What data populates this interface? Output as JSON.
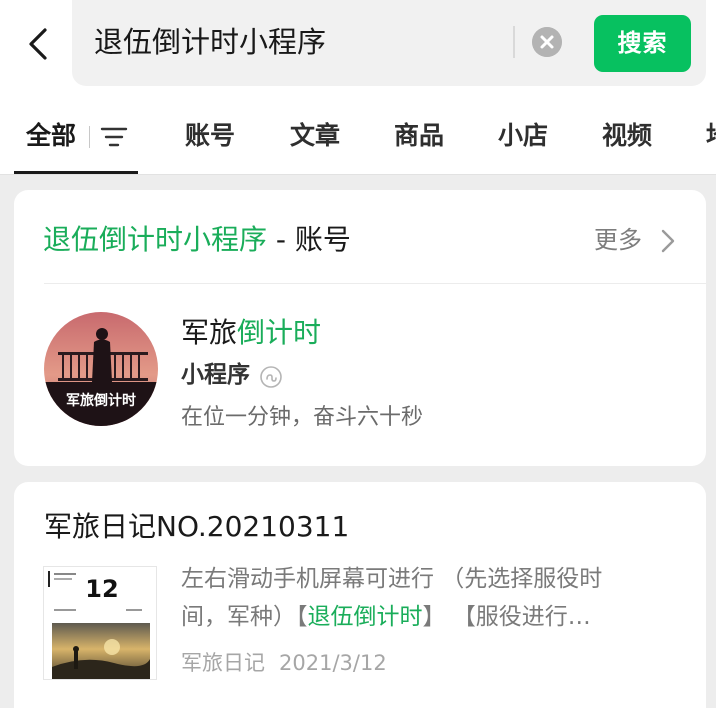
{
  "search": {
    "query": "退伍倒计时小程序",
    "button_label": "搜索"
  },
  "tabs": [
    {
      "label": "全部"
    },
    {
      "label": "账号"
    },
    {
      "label": "文章"
    },
    {
      "label": "商品"
    },
    {
      "label": "小店"
    },
    {
      "label": "视频"
    },
    {
      "label": "地"
    }
  ],
  "account_section": {
    "title_highlight": "退伍倒计时小程序",
    "title_suffix": " - 账号",
    "more_label": "更多",
    "account": {
      "name_plain": "军旅",
      "name_highlight": "倒计时",
      "type": "小程序",
      "description": "在位一分钟，奋斗六十秒",
      "avatar_text": "军旅倒计时"
    }
  },
  "article": {
    "title": "军旅日记NO.20210311",
    "snippet_line1": "左右滑动手机屏幕可进行 （先选择服役时",
    "snippet_line2_pre": "间，军种）【",
    "snippet_highlight": "退伍倒计时",
    "snippet_line2_post": "】 【服役进行…",
    "source": "军旅日记",
    "date": "2021/3/12",
    "thumb_number": "12"
  },
  "colors": {
    "accent": "#07c160",
    "highlight_text": "#1aad5a"
  },
  "icons": [
    "back-arrow-icon",
    "clear-icon",
    "filter-icon",
    "chevron-right-icon",
    "mini-program-icon"
  ]
}
